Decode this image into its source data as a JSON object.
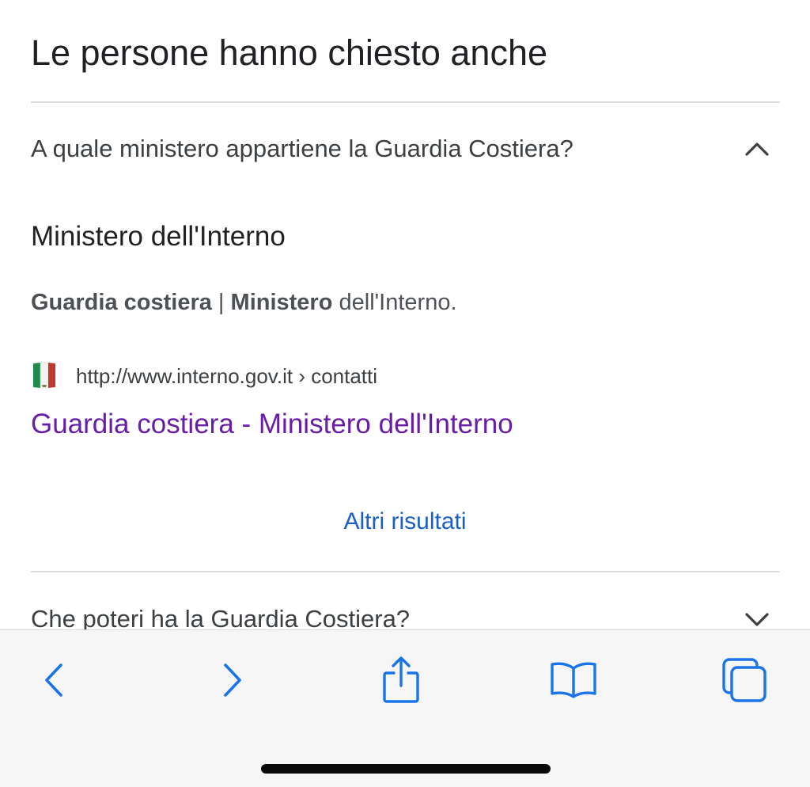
{
  "section": {
    "title": "Le persone hanno chiesto anche"
  },
  "questions": [
    {
      "text": "A quale ministero appartiene la Guardia Costiera?",
      "expanded": true,
      "chevron": "chevron-up-icon"
    },
    {
      "text": "Che poteri ha la Guardia Costiera?",
      "expanded": false,
      "chevron": "chevron-down-icon"
    }
  ],
  "answer": {
    "heading": "Ministero dell'Interno",
    "snippet": {
      "bold_1": "Guardia costiera",
      "separator": " | ",
      "bold_2": "Ministero",
      "rest": " dell'Interno."
    },
    "source": {
      "favicon": "italian-flag-icon",
      "url": "http://www.interno.gov.it › contatti"
    },
    "link_title": "Guardia costiera - Ministero dell'Interno",
    "link_color": "#681da8"
  },
  "more_results": {
    "label": "Altri risultati",
    "color": "#1a5fc8"
  },
  "toolbar": {
    "accent": "#1a73e8",
    "buttons": [
      "back-icon",
      "forward-icon",
      "share-icon",
      "bookmarks-icon",
      "tabs-icon"
    ]
  }
}
